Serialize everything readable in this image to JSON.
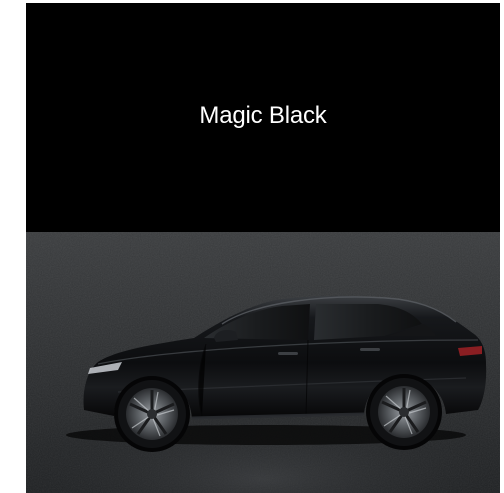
{
  "swatch": {
    "color_name": "Magic Black",
    "color_hex": "#000000"
  },
  "stage": {
    "background_top": "#3a3c3e",
    "background_bottom": "#1e2022",
    "car_body_color": "#0d0e10"
  },
  "image": {
    "subject": "car-side-view-icon"
  }
}
